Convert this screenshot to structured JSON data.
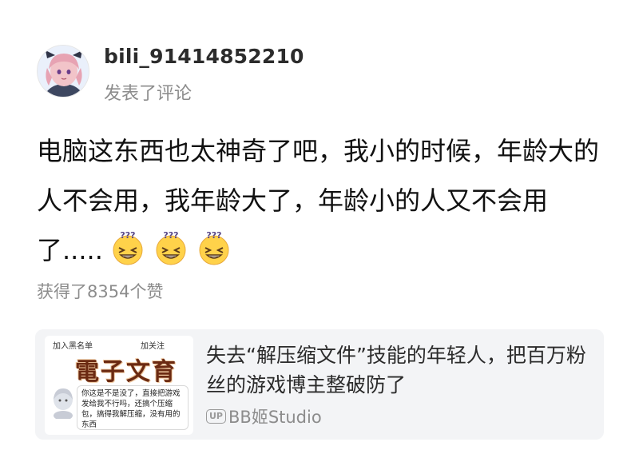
{
  "user": {
    "name": "bili_91414852210",
    "action": "发表了评论"
  },
  "comment": {
    "text": "电脑这东西也太神奇了吧，我小的时候，年龄大的人不会用，我年龄大了，年龄小的人又不会用了.....",
    "emojis": [
      "dizzy-face-emoji",
      "dizzy-face-emoji",
      "dizzy-face-emoji"
    ]
  },
  "likes_text": "获得了8354个赞",
  "linked_video": {
    "title": "失去“解压缩文件”技能的年轻人，把百万粉丝的游戏博主整破防了",
    "author_badge": "UP",
    "author": "BB姬Studio",
    "thumbnail": {
      "top_left_text": "加入黑名单",
      "top_right_text": "加关注",
      "brand_text": "電子文育",
      "bubble_text": "你这是不是没了，直接把游戏发给我不行吗，还搞个压缩包，搞得我解压缩，没有用的东西"
    }
  }
}
